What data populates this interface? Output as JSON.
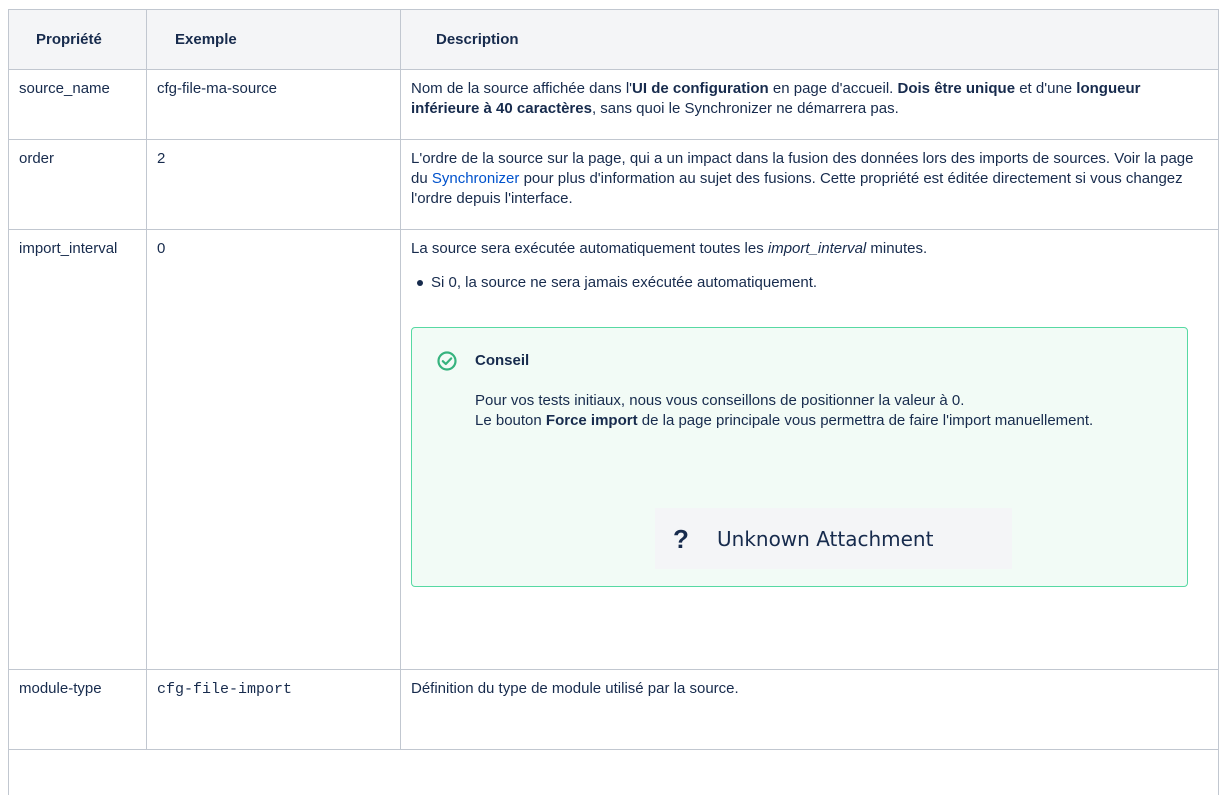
{
  "headers": [
    "Propriété",
    "Exemple",
    "Description"
  ],
  "rows": [
    {
      "property": "source_name",
      "example": "cfg-file-ma-source",
      "desc": {
        "t1": "Nom de la source affichée dans l'",
        "b1": "UI de configuration",
        "t2": " en page d'accueil. ",
        "b2": "Dois être unique",
        "t3": " et d'une ",
        "b3": "longueur inférieure à 40 caractères",
        "t4": ", sans quoi le Synchronizer ne démarrera pas."
      }
    },
    {
      "property": "order",
      "example": "2",
      "desc": {
        "t1": "L'ordre de la source sur la page, qui a un impact dans la fusion des données lors des imports de sources. Voir la page du ",
        "link": "Synchronizer",
        "t2": " pour plus d'information au sujet des fusions. Cette propriété est éditée directement si vous changez l'ordre depuis l'interface."
      }
    },
    {
      "property": "import_interval",
      "example": "0",
      "desc": {
        "t1": "La source sera exécutée automatiquement toutes les ",
        "em": "import_interval",
        "t2": " minutes.",
        "bullet": "Si 0, la source ne sera jamais exécutée automatiquement."
      },
      "panel": {
        "title": "Conseil",
        "line1": "Pour vos tests initiaux, nous vous conseillons de positionner la valeur à 0.",
        "line2a": "Le bouton ",
        "line2b": "Force import",
        "line2c": " de la page principale vous permettra de faire l'import manuellement.",
        "attachment_icon": "question-mark-icon",
        "attachment": "Unknown Attachment",
        "border_color": "#57d9a3",
        "bg_color": "#f2fbf6",
        "icon_color": "#36b37e"
      }
    },
    {
      "property": "module-type",
      "example": "cfg-file-import",
      "desc": {
        "t1": "Définition du type de module utilisé par la source."
      }
    }
  ]
}
